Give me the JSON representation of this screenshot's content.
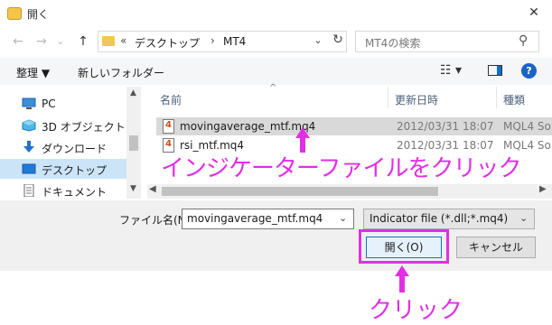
{
  "window": {
    "title": "開く",
    "close_glyph": "✕"
  },
  "nav": {
    "back_glyph": "←",
    "forward_glyph": "→",
    "recent_glyph": "⌄",
    "up_glyph": "↑",
    "address": {
      "chevron": "«",
      "segments": [
        "デスクトップ",
        "MT4"
      ],
      "separator": "›"
    },
    "search_placeholder": "MT4の検索"
  },
  "toolbar": {
    "organize": "整理 ▼",
    "new_folder": "新しいフォルダー",
    "view_glyph": "☷ ▾",
    "help_glyph": "?"
  },
  "sidebar": {
    "items": [
      {
        "label": "PC",
        "icon": "pc-icon"
      },
      {
        "label": "3D オブジェクト",
        "icon": "3d-objects-icon"
      },
      {
        "label": "ダウンロード",
        "icon": "download-icon"
      },
      {
        "label": "デスクトップ",
        "icon": "desktop-icon",
        "selected": true
      },
      {
        "label": "ドキュメント",
        "icon": "documents-icon"
      }
    ]
  },
  "filelist": {
    "columns": [
      "名前",
      "更新日時",
      "種類"
    ],
    "sort_glyph": "^",
    "rows": [
      {
        "name": "movingaverage_mtf.mq4",
        "date": "2012/03/31 18:07",
        "type": "MQL4 So",
        "selected": true
      },
      {
        "name": "rsi_mtf.mq4",
        "date": "2012/03/31 18:07",
        "type": "MQL4 So",
        "selected": false
      }
    ]
  },
  "bottom": {
    "filename_label": "ファイル名(N):",
    "filename_value": "movingaverage_mtf.mq4",
    "filter_value": "Indicator file (*.dll;*.mq4)",
    "open_label": "開く(O)",
    "cancel_label": "キャンセル"
  },
  "annotations": {
    "select_file": "インジケーターファイルをクリック",
    "click": "クリック",
    "color": "#e22ee6"
  }
}
